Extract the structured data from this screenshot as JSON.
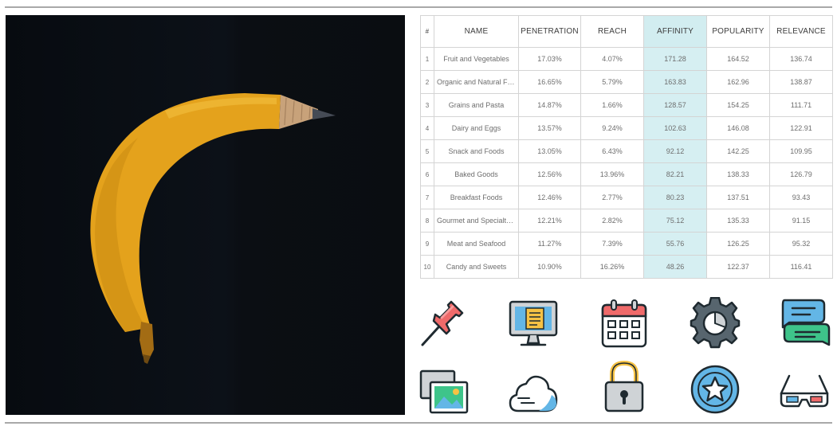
{
  "table": {
    "headers": {
      "index": "#",
      "name": "NAME",
      "penetration": "PENETRATION",
      "reach": "REACH",
      "affinity": "AFFINITY",
      "popularity": "POPULARITY",
      "relevance": "RELEVANCE"
    },
    "rows": [
      {
        "index": "1",
        "name": "Fruit and Vegetables",
        "penetration": "17.03%",
        "reach": "4.07%",
        "affinity": "171.28",
        "popularity": "164.52",
        "relevance": "136.74"
      },
      {
        "index": "2",
        "name": "Organic and Natural Fo...",
        "penetration": "16.65%",
        "reach": "5.79%",
        "affinity": "163.83",
        "popularity": "162.96",
        "relevance": "138.87"
      },
      {
        "index": "3",
        "name": "Grains and Pasta",
        "penetration": "14.87%",
        "reach": "1.66%",
        "affinity": "128.57",
        "popularity": "154.25",
        "relevance": "111.71"
      },
      {
        "index": "4",
        "name": "Dairy and Eggs",
        "penetration": "13.57%",
        "reach": "9.24%",
        "affinity": "102.63",
        "popularity": "146.08",
        "relevance": "122.91"
      },
      {
        "index": "5",
        "name": "Snack and Foods",
        "penetration": "13.05%",
        "reach": "6.43%",
        "affinity": "92.12",
        "popularity": "142.25",
        "relevance": "109.95"
      },
      {
        "index": "6",
        "name": "Baked Goods",
        "penetration": "12.56%",
        "reach": "13.96%",
        "affinity": "82.21",
        "popularity": "138.33",
        "relevance": "126.79"
      },
      {
        "index": "7",
        "name": "Breakfast Foods",
        "penetration": "12.46%",
        "reach": "2.77%",
        "affinity": "80.23",
        "popularity": "137.51",
        "relevance": "93.43"
      },
      {
        "index": "8",
        "name": "Gourmet and Specialty ...",
        "penetration": "12.21%",
        "reach": "2.82%",
        "affinity": "75.12",
        "popularity": "135.33",
        "relevance": "91.15"
      },
      {
        "index": "9",
        "name": "Meat and Seafood",
        "penetration": "11.27%",
        "reach": "7.39%",
        "affinity": "55.76",
        "popularity": "126.25",
        "relevance": "95.32"
      },
      {
        "index": "10",
        "name": "Candy and Sweets",
        "penetration": "10.90%",
        "reach": "16.26%",
        "affinity": "48.26",
        "popularity": "122.37",
        "relevance": "116.41"
      }
    ],
    "highlight_color": "#d6eff2"
  },
  "photo": {
    "subject": "banana-pencil"
  },
  "icons": [
    {
      "name": "pushpin-icon"
    },
    {
      "name": "monitor-icon"
    },
    {
      "name": "calendar-icon"
    },
    {
      "name": "gear-icon"
    },
    {
      "name": "chat-bubbles-icon"
    },
    {
      "name": "pictures-icon"
    },
    {
      "name": "cloud-icon"
    },
    {
      "name": "padlock-icon"
    },
    {
      "name": "star-badge-icon"
    },
    {
      "name": "3d-glasses-icon"
    }
  ],
  "colors": {
    "icon_outline": "#1f2a30",
    "red": "#ef6a6a",
    "blue": "#63b6e6",
    "green": "#3ec48a",
    "yellow": "#f6c244",
    "gray": "#cfd3d6"
  }
}
